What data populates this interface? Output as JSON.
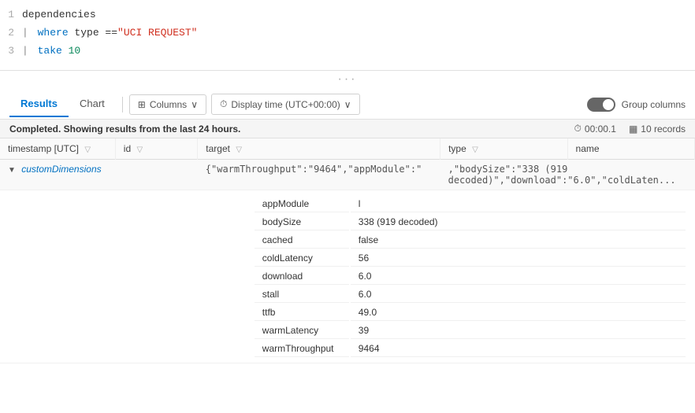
{
  "editor": {
    "lines": [
      {
        "num": 1,
        "tokens": [
          {
            "text": "dependencies",
            "type": "plain"
          }
        ]
      },
      {
        "num": 2,
        "tokens": [
          {
            "text": "| ",
            "type": "pipe"
          },
          {
            "text": "where",
            "type": "keyword"
          },
          {
            "text": " type == ",
            "type": "plain"
          },
          {
            "text": "\"UCI REQUEST\"",
            "type": "string"
          }
        ]
      },
      {
        "num": 3,
        "tokens": [
          {
            "text": "| ",
            "type": "pipe"
          },
          {
            "text": "take",
            "type": "keyword"
          },
          {
            "text": " 10",
            "type": "number"
          }
        ]
      }
    ]
  },
  "toolbar": {
    "tabs": [
      {
        "label": "Results",
        "active": true
      },
      {
        "label": "Chart",
        "active": false
      }
    ],
    "columns_btn": "Columns",
    "display_time_btn": "Display time (UTC+00:00)",
    "group_columns_label": "Group columns"
  },
  "status": {
    "message": "Completed. Showing results from the last 24 hours.",
    "duration": "00:00.1",
    "records": "10 records"
  },
  "table": {
    "columns": [
      {
        "label": "timestamp [UTC]"
      },
      {
        "label": "id"
      },
      {
        "label": "target"
      },
      {
        "label": "type"
      },
      {
        "label": "name"
      }
    ],
    "expanded_row": {
      "label": "customDimensions",
      "preview": "{\"warmThroughput\":\"9464\",\"appModule\":\"",
      "overflow": ",\"bodySize\":\"338 (919 decoded)\",\"download\":\"6.0\",\"coldLaten..."
    },
    "sub_rows": [
      {
        "key": "appModule",
        "value": "l"
      },
      {
        "key": "bodySize",
        "value": "338 (919 decoded)"
      },
      {
        "key": "cached",
        "value": "false"
      },
      {
        "key": "coldLatency",
        "value": "56"
      },
      {
        "key": "download",
        "value": "6.0"
      },
      {
        "key": "stall",
        "value": "6.0"
      },
      {
        "key": "ttfb",
        "value": "49.0"
      },
      {
        "key": "warmLatency",
        "value": "39"
      },
      {
        "key": "warmThroughput",
        "value": "9464"
      }
    ]
  }
}
